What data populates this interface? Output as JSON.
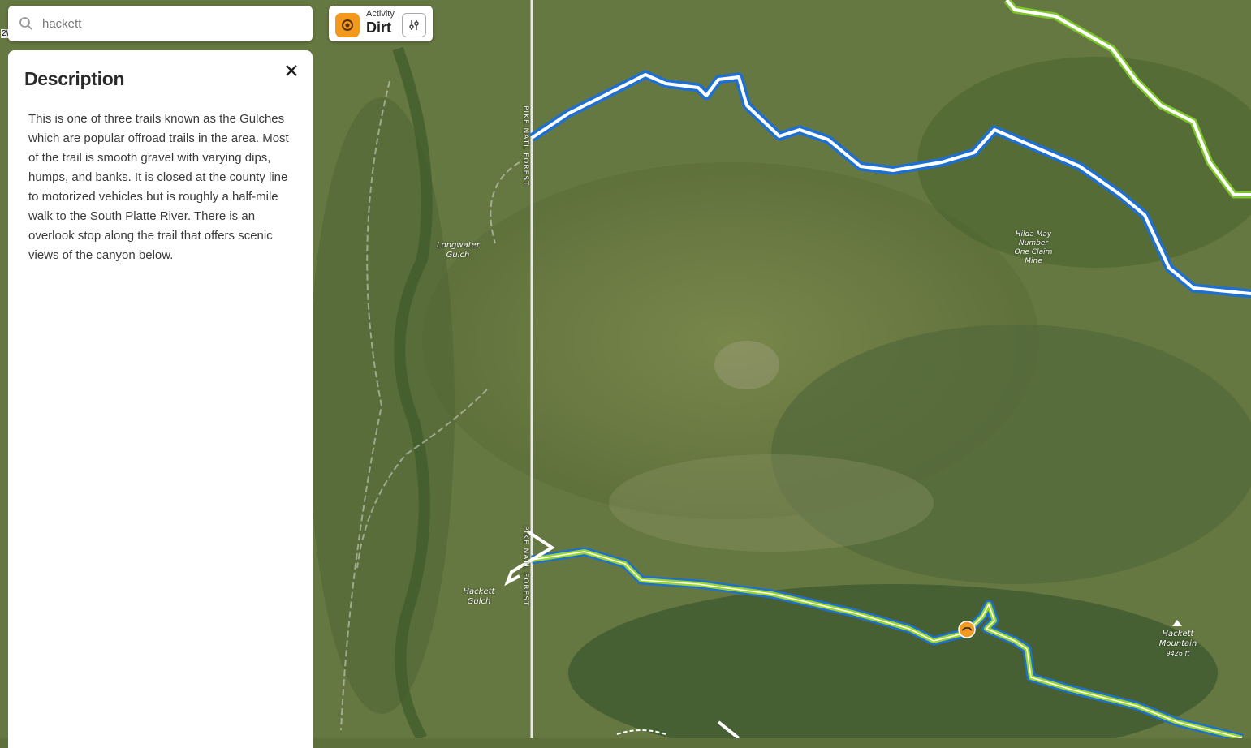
{
  "search": {
    "value": "hackett",
    "icon": "search-icon"
  },
  "activity": {
    "caption": "Activity",
    "value": "Dirt",
    "icon": "dirt-bike-icon",
    "filter_icon": "sliders-icon",
    "accent": "#f39a1e"
  },
  "panel": {
    "title": "Description",
    "close_icon": "close-icon",
    "body": "This is one of three trails known as the Gulches which are popular offroad trails in the area. Most of the trail is smooth gravel with varying dips, humps, and banks. It is closed at the county line to motorized vehicles but is roughly a half-mile walk to the South Platte River. There is an overlook stop along the trail that offers scenic views of the canyon below."
  },
  "map": {
    "edge_text": "2\\",
    "labels": {
      "longwater_1": "Longwater",
      "longwater_2": "Gulch",
      "hilda_1": "Hilda May",
      "hilda_2": "Number",
      "hilda_3": "One Claim",
      "hilda_4": "Mine",
      "hackett_gulch_1": "Hackett",
      "hackett_gulch_2": "Gulch",
      "hackett_mtn_1": "Hackett",
      "hackett_mtn_2": "Mountain",
      "hackett_mtn_3": "9426 ft"
    },
    "road_label_top": "PIKE NATL FOREST",
    "road_label_bottom": "PIKE NATL FOREST",
    "colors": {
      "trail_green": "#9ad52c",
      "trail_blue": "#1e6fd0",
      "marker": "#f39a1e"
    }
  }
}
